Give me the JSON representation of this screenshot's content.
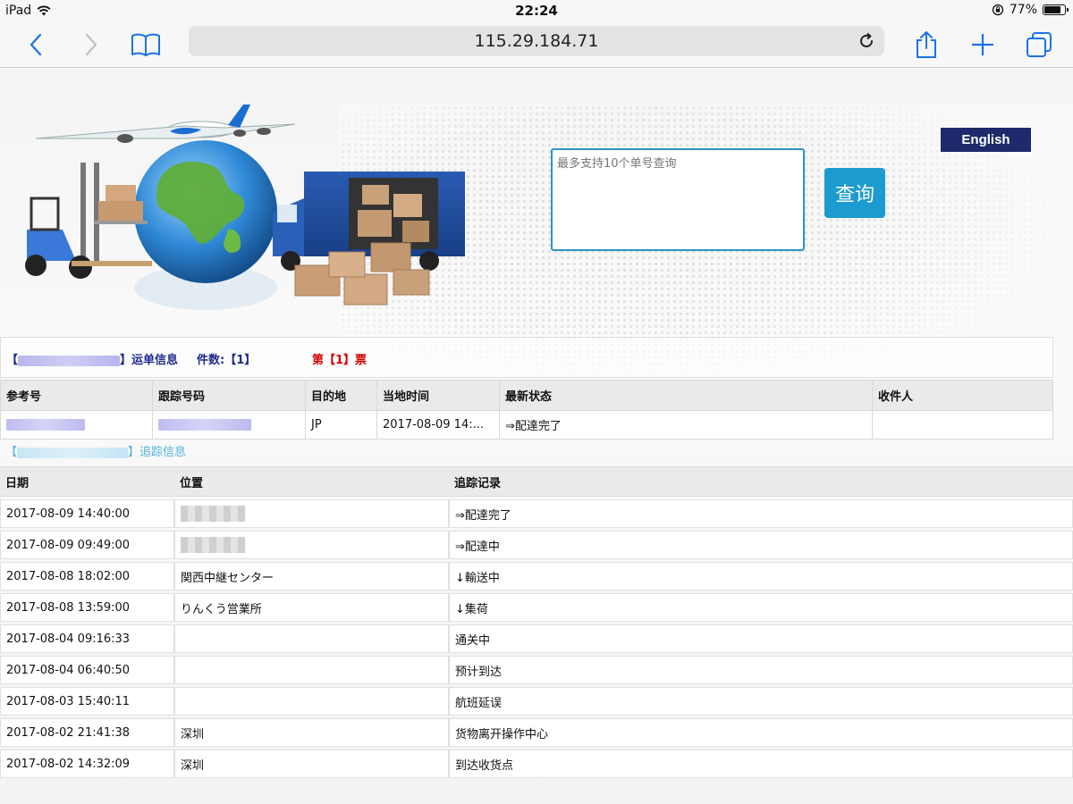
{
  "status_bar": {
    "device": "iPad",
    "time": "22:24",
    "battery": "77%",
    "battery_level": 0.77
  },
  "browser": {
    "url": "115.29.184.71"
  },
  "header": {
    "query_placeholder": "最多支持10个单号查询",
    "query_button": "查询",
    "language_button": "English"
  },
  "waybill": {
    "info_label": "】运单信息",
    "count_label": "件数:【1】",
    "ticket_label": "第【1】票"
  },
  "summary_table": {
    "headers": [
      "参考号",
      "跟踪号码",
      "目的地",
      "当地时间",
      "最新状态",
      "收件人"
    ],
    "row": {
      "destination": "JP",
      "local_time": "2017-08-09 14:...",
      "latest_status": "⇒配達完了",
      "recipient": ""
    }
  },
  "tracking": {
    "title": "】追踪信息",
    "headers": [
      "日期",
      "位置",
      "追踪记录"
    ],
    "rows": [
      {
        "date": "2017-08-09 14:40:00",
        "location": "",
        "record": "⇒配達完了"
      },
      {
        "date": "2017-08-09 09:49:00",
        "location": "",
        "record": "⇒配達中"
      },
      {
        "date": "2017-08-08 18:02:00",
        "location": "関西中継センター",
        "record": "↓輸送中"
      },
      {
        "date": "2017-08-08 13:59:00",
        "location": "りんくう営業所",
        "record": "↓集荷"
      },
      {
        "date": "2017-08-04 09:16:33",
        "location": "",
        "record": "通关中"
      },
      {
        "date": "2017-08-04 06:40:50",
        "location": "",
        "record": "预计到达"
      },
      {
        "date": "2017-08-03 15:40:11",
        "location": "",
        "record": "航班延误"
      },
      {
        "date": "2017-08-02 21:41:38",
        "location": "深圳",
        "record": "货物离开操作中心"
      },
      {
        "date": "2017-08-02 14:32:09",
        "location": "深圳",
        "record": "到达收货点"
      }
    ]
  },
  "colors": {
    "accent": "#1b9bd0",
    "brand_dark": "#1d2a6b",
    "waybill_blue": "#1f2a8c",
    "ticket_red": "#d30000"
  }
}
